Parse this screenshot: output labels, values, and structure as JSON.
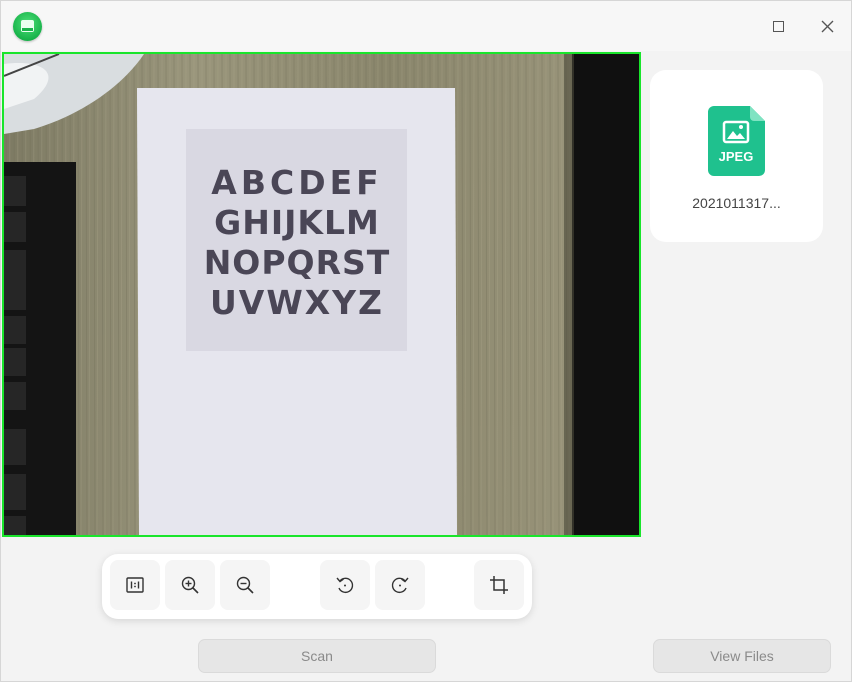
{
  "app": {
    "icon": "scanner-app-icon"
  },
  "window_controls": {
    "maximize_icon": "maximize-icon",
    "close_icon": "close-icon"
  },
  "camera": {
    "border_color": "#19e52b",
    "poster_rows": [
      "ABCDEF",
      "GHIJKLM",
      "NOPQRST",
      "UVWXYZ"
    ]
  },
  "thumbnail": {
    "badge": "JPEG",
    "filename": "2021011317..."
  },
  "toolbar": {
    "items": [
      {
        "name": "actual-size-button",
        "icon": "one-to-one-icon"
      },
      {
        "name": "zoom-in-button",
        "icon": "zoom-in-icon"
      },
      {
        "name": "zoom-out-button",
        "icon": "zoom-out-icon"
      },
      {
        "name": "rotate-left-button",
        "icon": "rotate-left-icon"
      },
      {
        "name": "rotate-right-button",
        "icon": "rotate-right-icon"
      },
      {
        "name": "crop-button",
        "icon": "crop-icon"
      }
    ]
  },
  "actions": {
    "scan_label": "Scan",
    "view_files_label": "View Files"
  },
  "colors": {
    "accent": "#19e52b",
    "jpeg_badge": "#1fc18e"
  }
}
